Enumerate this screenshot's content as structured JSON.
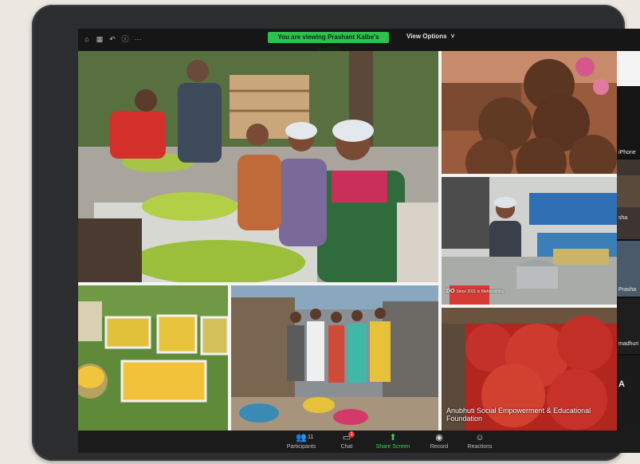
{
  "topbar": {
    "icons": [
      "home-icon",
      "grid-icon",
      "back-icon",
      "info-icon",
      "more-icon"
    ],
    "more_glyph": "···",
    "share_banner": "You are viewing Prashant Kalbe's screen",
    "view_options": "View Options",
    "view_options_chevron": "˅"
  },
  "gallery": {
    "caption_org": "Anubhuti Social Empowerment & Educational Foundation",
    "caption_small": "Since 2011 in Maharashtra",
    "caption_small_brand": "DO"
  },
  "participants_strip": {
    "names": [
      "iPhone",
      "sha",
      "Prasha",
      "madhuri",
      "A"
    ]
  },
  "toolbar": {
    "participants_label": "Participants",
    "participants_count": "11",
    "chat_label": "Chat",
    "chat_badge": "1",
    "share_label": "Share Screen",
    "record_label": "Record",
    "reactions_label": "Reactions"
  },
  "colors": {
    "share_green": "#2fbf4f",
    "frame": "#2b2d2f",
    "toolbar_bg": "#1b1b1b"
  }
}
